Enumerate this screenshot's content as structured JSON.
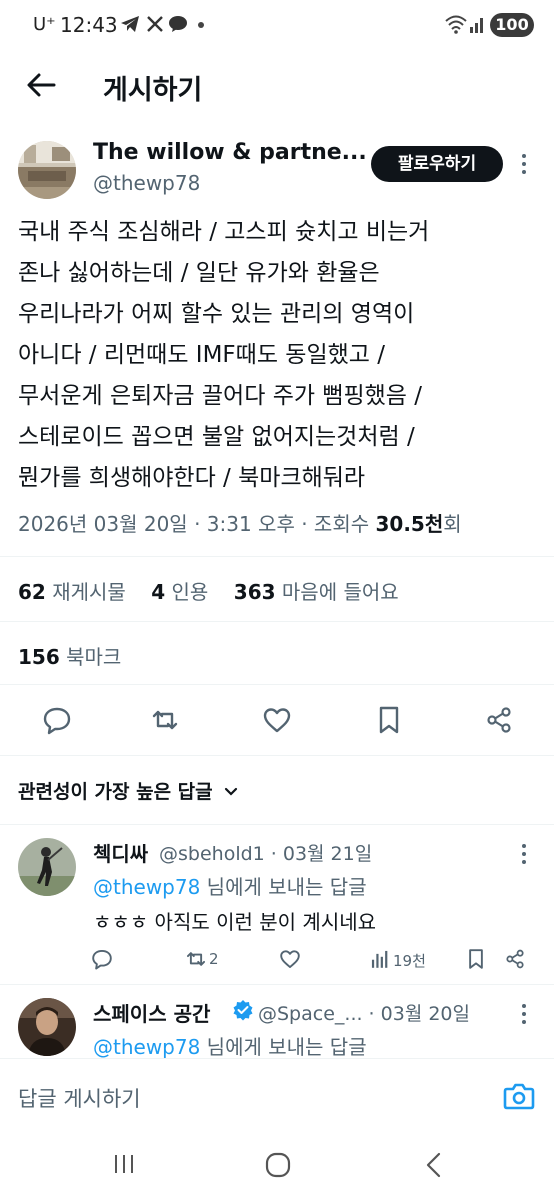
{
  "status_bar": {
    "carrier": "U⁺",
    "time": "12:43",
    "battery": "100",
    "icons": [
      "telegram-icon",
      "x-icon",
      "talk-icon",
      "dot-icon",
      "wifi-icon",
      "signal-icon"
    ]
  },
  "header": {
    "back_icon": "arrow-left-icon",
    "title": "게시하기"
  },
  "post": {
    "author_name": "The willow & partne...",
    "author_handle": "@thewp78",
    "follow_label": "팔로우하기",
    "body_lines": [
      "국내 주식 조심해라 / 고스피 슛치고 비는거",
      "존나 싫어하는데 / 일단 유가와 환율은",
      "우리나라가 어찌 할수 있는 관리의 영역이",
      "아니다 / 리먼때도 IMF때도 동일했고 /",
      "무서운게 은퇴자금 끌어다 주가 뻠핑했음 /",
      "스테로이드 꼽으면 불알 없어지는것처럼 /",
      "뭔가를 희생해야한다 / 북마크해둬라"
    ],
    "timestamp": "2026년 03월 20일 · 3:31 오후 · 조회수 ",
    "views_value": "30.5천",
    "views_suffix": "회",
    "stats": {
      "reposts_count": "62",
      "reposts_label": "재게시물",
      "quotes_count": "4",
      "quotes_label": "인용",
      "likes_count": "363",
      "likes_label": "마음에 들어요",
      "bookmarks_count": "156",
      "bookmarks_label": "북마크"
    },
    "actions": [
      "reply-icon",
      "repost-icon",
      "like-icon",
      "bookmark-icon",
      "share-icon"
    ]
  },
  "replies_sort": {
    "label": "관련성이 가장 높은 답글"
  },
  "replies": [
    {
      "name": "첵디싸",
      "meta": "@sbehold1 · 03월 21일",
      "reply_to_mention": "@thewp78",
      "reply_to_suffix": " 님에게 보내는 답글",
      "text": "ㅎㅎㅎ 아직도 이런 분이 계시네요",
      "repost_count": "2",
      "views_count": "19천"
    },
    {
      "name": "스페이스 공간",
      "meta": "@Space_... · 03월 20일",
      "reply_to_mention": "@thewp78",
      "reply_to_suffix": " 님에게 보내는 답글",
      "verified": true
    }
  ],
  "composer": {
    "placeholder": "답글 게시하기"
  },
  "colors": {
    "accent": "#1d9bf0",
    "text": "#0f1419",
    "secondary": "#536471",
    "divider": "#eff3f4"
  }
}
